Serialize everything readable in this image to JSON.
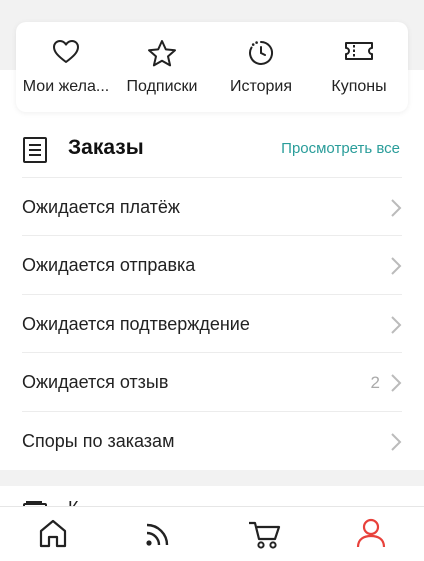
{
  "quick_actions": [
    {
      "label": "Мои жела...",
      "icon": "heart-icon"
    },
    {
      "label": "Подписки",
      "icon": "star-icon"
    },
    {
      "label": "История",
      "icon": "history-icon"
    },
    {
      "label": "Купоны",
      "icon": "ticket-icon"
    }
  ],
  "orders": {
    "title": "Заказы",
    "view_all": "Просмотреть все",
    "rows": [
      {
        "label": "Ожидается платёж",
        "count": ""
      },
      {
        "label": "Ожидается отправка",
        "count": ""
      },
      {
        "label": "Ожидается подтверждение",
        "count": ""
      },
      {
        "label": "Ожидается отзыв",
        "count": "2"
      },
      {
        "label": "Споры по заказам",
        "count": ""
      }
    ]
  },
  "next_section": {
    "label": "К"
  },
  "tabbar": [
    {
      "icon": "home-icon"
    },
    {
      "icon": "feed-icon"
    },
    {
      "icon": "cart-icon"
    },
    {
      "icon": "account-icon"
    }
  ],
  "colors": {
    "accent": "#2a9d9a",
    "active_tab": "#e8413b"
  }
}
